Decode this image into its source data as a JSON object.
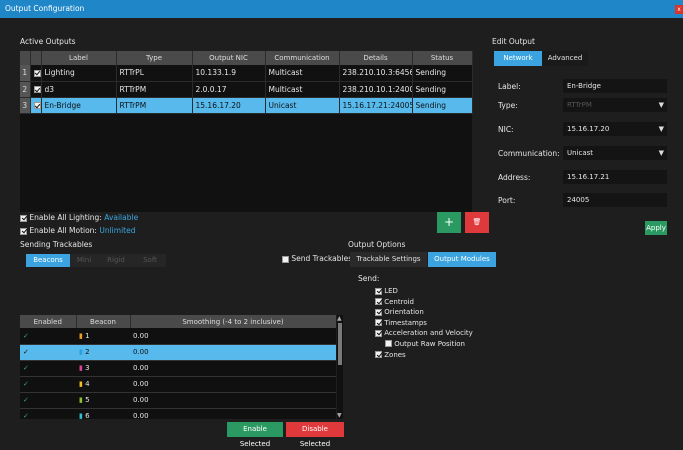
{
  "window": {
    "title": "Output Configuration",
    "close_glyph": "x"
  },
  "active_outputs": {
    "heading": "Active Outputs",
    "columns": [
      "Label",
      "Type",
      "Output NIC",
      "Communication",
      "Details",
      "Status"
    ],
    "rows": [
      {
        "index": "1",
        "checked": true,
        "label": "Lighting",
        "type": "RTTrPL",
        "nic": "10.133.1.9",
        "comm": "Multicast",
        "details": "238.210.10.3:6456",
        "status": "Sending"
      },
      {
        "index": "2",
        "checked": true,
        "label": "d3",
        "type": "RTTrPM",
        "nic": "2.0.0.17",
        "comm": "Multicast",
        "details": "238.210.10.1:24002",
        "status": "Sending"
      },
      {
        "index": "3",
        "checked": true,
        "label": "En-Bridge",
        "type": "RTTrPM",
        "nic": "15.16.17.20",
        "comm": "Unicast",
        "details": "15.16.17.21:24005",
        "status": "Sending"
      }
    ],
    "enable_lighting_label": "Enable All Lighting:",
    "enable_lighting_value": "Available",
    "enable_motion_label": "Enable All Motion:",
    "enable_motion_value": "Unlimited",
    "add_glyph": "+",
    "delete_glyph": "🗑"
  },
  "edit_output": {
    "heading": "Edit Output",
    "tabs": [
      "Network",
      "Advanced"
    ],
    "active_tab": "Network",
    "fields": {
      "label": {
        "name": "Label:",
        "value": "En-Bridge"
      },
      "type": {
        "name": "Type:",
        "value": "RTTrPM"
      },
      "nic": {
        "name": "NIC:",
        "value": "15.16.17.20"
      },
      "communication": {
        "name": "Communication:",
        "value": "Unicast"
      },
      "address": {
        "name": "Address:",
        "value": "15.16.17.21"
      },
      "port": {
        "name": "Port:",
        "value": "24005"
      }
    },
    "dropdown_glyph": "▼",
    "apply_label": "Apply"
  },
  "sending_trackables": {
    "heading": "Sending Trackables",
    "filters": [
      "Beacons",
      "Mini",
      "Rigid",
      "Soft"
    ],
    "active_filter": "Beacons",
    "send_trackables_label": "Send Trackables",
    "columns": [
      "Enabled",
      "Beacon",
      "Smoothing (-4 to 2 inclusive)"
    ],
    "rows": [
      {
        "enabled": "✓",
        "color": "#f0a020",
        "num": "1",
        "smoothing": "0.00"
      },
      {
        "enabled": "✓",
        "color": "#2aa0e0",
        "num": "2",
        "smoothing": "0.00"
      },
      {
        "enabled": "✓",
        "color": "#e040a0",
        "num": "3",
        "smoothing": "0.00"
      },
      {
        "enabled": "✓",
        "color": "#f0c020",
        "num": "4",
        "smoothing": "0.00"
      },
      {
        "enabled": "✓",
        "color": "#90c030",
        "num": "5",
        "smoothing": "0.00"
      },
      {
        "enabled": "✓",
        "color": "#30c0d0",
        "num": "6",
        "smoothing": "0.00"
      }
    ],
    "selected_row": 1,
    "enable_selected_label": "Enable Selected",
    "disable_selected_label": "Disable Selected"
  },
  "output_options": {
    "heading": "Output Options",
    "tabs": [
      "Trackable Settings",
      "Output Modules"
    ],
    "active_tab": "Output Modules",
    "send_label": "Send:",
    "items": [
      {
        "label": "LED",
        "checked": true,
        "indent": false
      },
      {
        "label": "Centroid",
        "checked": true,
        "indent": false
      },
      {
        "label": "Orientation",
        "checked": true,
        "indent": false
      },
      {
        "label": "Timestamps",
        "checked": true,
        "indent": false
      },
      {
        "label": "Acceleration and Velocity",
        "checked": true,
        "indent": false
      },
      {
        "label": "Output Raw Position",
        "checked": false,
        "indent": true
      },
      {
        "label": "Zones",
        "checked": true,
        "indent": false
      }
    ]
  }
}
